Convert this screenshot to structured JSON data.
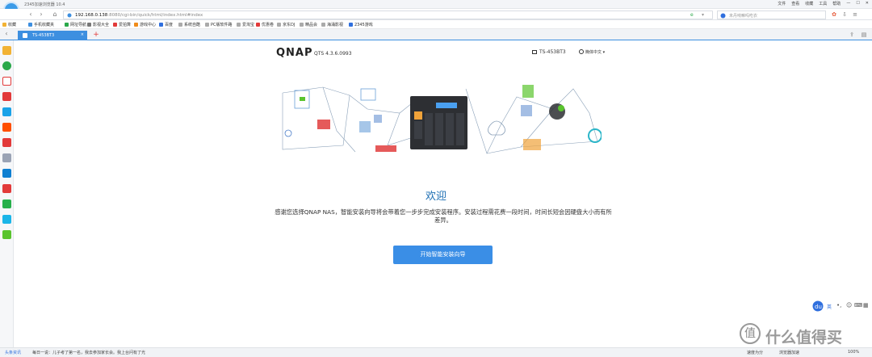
{
  "browser": {
    "title": "2345加速浏览器 10.4",
    "login_label": "登录",
    "menu": [
      "文件",
      "查看",
      "收藏",
      "工具",
      "帮助"
    ],
    "url_host": "192.168.0.138",
    "url_rest": ":8080/cgi-bin/quick/html/index.html#index",
    "search_placeholder": "未丹响嘛吗吃衣",
    "bookmarks": [
      "收藏",
      "手机收藏夹",
      "网址导航",
      "影视大全",
      "爱拍算",
      "游戏中心",
      "百度",
      "系统自酷",
      "PC版软件路",
      "爱淘宝",
      "优惠卷",
      "京东DJ",
      "精品会",
      "海涌影视",
      "2345游戏"
    ],
    "tab_label": "TS-453BT3",
    "accent": "#3d8fe0"
  },
  "page": {
    "logo": "QNAP",
    "version": "QTS 4.3.6.0993",
    "model": "TS-453BT3",
    "language": "簡体中文",
    "welcome": "欢迎",
    "description": "感谢您选择QNAP NAS，智能安装向导将会带着您一步步完成安装程序。安装过程需花费一段时间，时间长短会因硬盘大小而有所差异。",
    "start_button": "开始智能安装向导",
    "button_color": "#3a8ee6",
    "title_color": "#1d6fb3"
  },
  "status": {
    "news": "头条资讯",
    "ticker": "每日一说：儿子考了第一名，我去参加家长会。我上台问有了光",
    "downloads": "速度为分",
    "accel": "浏览器加速",
    "zoom": "100%"
  },
  "tools": {
    "ime_lang": "英"
  },
  "watermark": {
    "symbol": "值",
    "text": "什么值得买"
  }
}
